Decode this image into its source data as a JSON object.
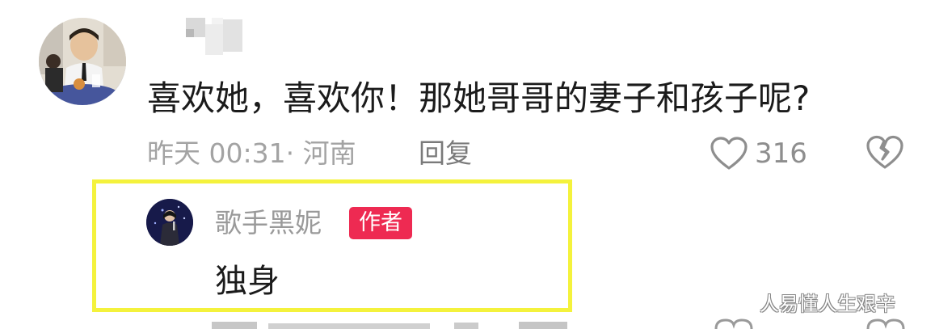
{
  "comment": {
    "text": "喜欢她，喜欢你！那她哥哥的妻子和孩子呢?",
    "meta": "昨天 00:31· 河南",
    "reply_label": "回复",
    "like_count": "316",
    "icons": {
      "like": "heart-icon",
      "dislike": "broken-heart-icon"
    }
  },
  "reply": {
    "author_name": "歌手黑妮",
    "author_badge": "作者",
    "text": "独身",
    "colors": {
      "badge": "#ee2a52",
      "highlight_border": "#f4f23c"
    }
  },
  "watermark": "人易懂人生艰辛"
}
